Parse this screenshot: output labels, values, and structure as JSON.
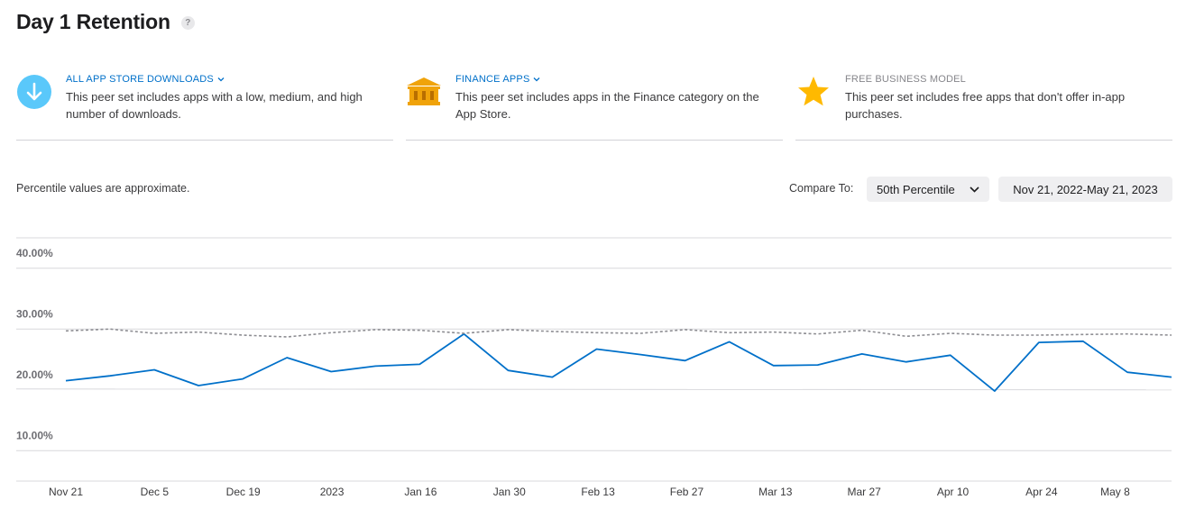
{
  "page": {
    "title": "Day 1 Retention",
    "help_symbol": "?"
  },
  "peer_sets": [
    {
      "title": "ALL APP STORE DOWNLOADS",
      "has_dropdown": true,
      "icon": "download-arrow-icon",
      "icon_color": "#5ac8fa",
      "description": "This peer set includes apps with a low, medium, and high number of downloads."
    },
    {
      "title": "FINANCE APPS",
      "has_dropdown": true,
      "icon": "bank-building-icon",
      "icon_color": "#f0a30a",
      "description": "This peer set includes apps in the Finance category on the App Store."
    },
    {
      "title": "FREE BUSINESS MODEL",
      "has_dropdown": false,
      "icon": "star-icon",
      "icon_color": "#ffb900",
      "description": "This peer set includes free apps that don't offer in-app purchases."
    }
  ],
  "controls": {
    "note": "Percentile values are approximate.",
    "compare_label": "Compare To:",
    "percentile_value": "50th Percentile",
    "date_range": "Nov 21, 2022-May 21, 2023"
  },
  "chart_data": {
    "type": "line",
    "ylim": [
      5,
      45
    ],
    "yticks": [
      10,
      20,
      30,
      40
    ],
    "ytick_labels": [
      "10.00%",
      "20.00%",
      "30.00%",
      "40.00%"
    ],
    "grid": true,
    "x_tick_labels": [
      "Nov 21",
      "Dec 5",
      "Dec 19",
      "2023",
      "Jan 16",
      "Jan 30",
      "Feb 13",
      "Feb 27",
      "Mar 13",
      "Mar 27",
      "Apr 10",
      "Apr 24",
      "May 8"
    ],
    "x_tick_index": [
      0,
      2,
      4,
      6,
      8,
      10,
      12,
      14,
      16,
      18,
      20,
      22,
      23.66
    ],
    "x_count": 25,
    "series": [
      {
        "style": "solid",
        "color": "#0070c9",
        "values": [
          21.5,
          22.3,
          23.3,
          20.7,
          21.8,
          25.3,
          23.0,
          23.9,
          24.2,
          29.2,
          23.2,
          22.1,
          26.7,
          25.8,
          24.8,
          27.9,
          24.0,
          24.1,
          25.9,
          24.6,
          25.7,
          19.8,
          27.8,
          28.0,
          22.9,
          22.1
        ]
      },
      {
        "style": "dashed",
        "color": "#8e8e93",
        "values": [
          29.7,
          30.0,
          29.3,
          29.5,
          29.0,
          28.7,
          29.4,
          29.9,
          29.8,
          29.3,
          29.9,
          29.6,
          29.4,
          29.3,
          29.9,
          29.4,
          29.5,
          29.2,
          29.8,
          28.8,
          29.3,
          29.0,
          29.0,
          29.1,
          29.2,
          29.0
        ]
      }
    ]
  }
}
